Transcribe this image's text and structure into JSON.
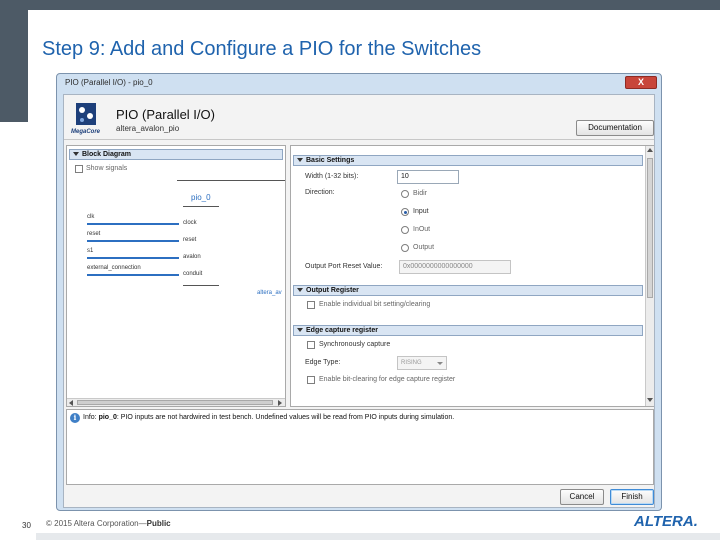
{
  "slide": {
    "title": "Step 9: Add and Configure a PIO for the Switches",
    "number": "30",
    "footer_copyright": "© 2015 Altera Corporation",
    "footer_dash": "—",
    "footer_public": "Public",
    "logo_text": "ALTERA."
  },
  "dialog": {
    "title": "PIO (Parallel I/O) - pio_0",
    "close_label": "X",
    "header": {
      "title": "PIO (Parallel I/O)",
      "subtitle": "altera_avalon_pio",
      "logo_text": "MegaCore",
      "documentation_button": "Documentation"
    },
    "block_diagram": {
      "section_label": "Block Diagram",
      "show_signals_label": "Show signals",
      "component_name": "pio_0",
      "ports": [
        {
          "label": "clk",
          "signal": "clock"
        },
        {
          "label": "reset",
          "signal": "reset"
        },
        {
          "label": "s1",
          "signal": "avalon"
        },
        {
          "label": "external_connection",
          "signal": "conduit"
        }
      ],
      "footer_label": "altera_av"
    },
    "basic_settings": {
      "section_label": "Basic Settings",
      "width_label": "Width (1-32 bits):",
      "width_value": "10",
      "direction_label": "Direction:",
      "direction_options": [
        "Bidir",
        "Input",
        "InOut",
        "Output"
      ],
      "direction_selected": "Input",
      "reset_label": "Output Port Reset Value:",
      "reset_value": "0x0000000000000000"
    },
    "output_register": {
      "section_label": "Output Register",
      "individual_bit_label": "Enable individual bit setting/clearing"
    },
    "edge_capture": {
      "section_label": "Edge capture register",
      "sync_capture_label": "Synchronously capture",
      "edge_type_label": "Edge Type:",
      "edge_type_value": "RISING",
      "bit_clearing_label": "Enable bit-clearing for edge capture register"
    },
    "message": {
      "prefix": "Info: ",
      "name": "pio_0",
      "text": ": PIO inputs are not hardwired in test bench. Undefined values will be read from PIO inputs during simulation."
    },
    "buttons": {
      "cancel": "Cancel",
      "finish": "Finish"
    }
  },
  "colors": {
    "title_blue": "#1f63ad",
    "chrome_gray": "#4d5a66",
    "dialog_frame": "#cfe0f1",
    "wire_blue": "#2c6fc1"
  }
}
